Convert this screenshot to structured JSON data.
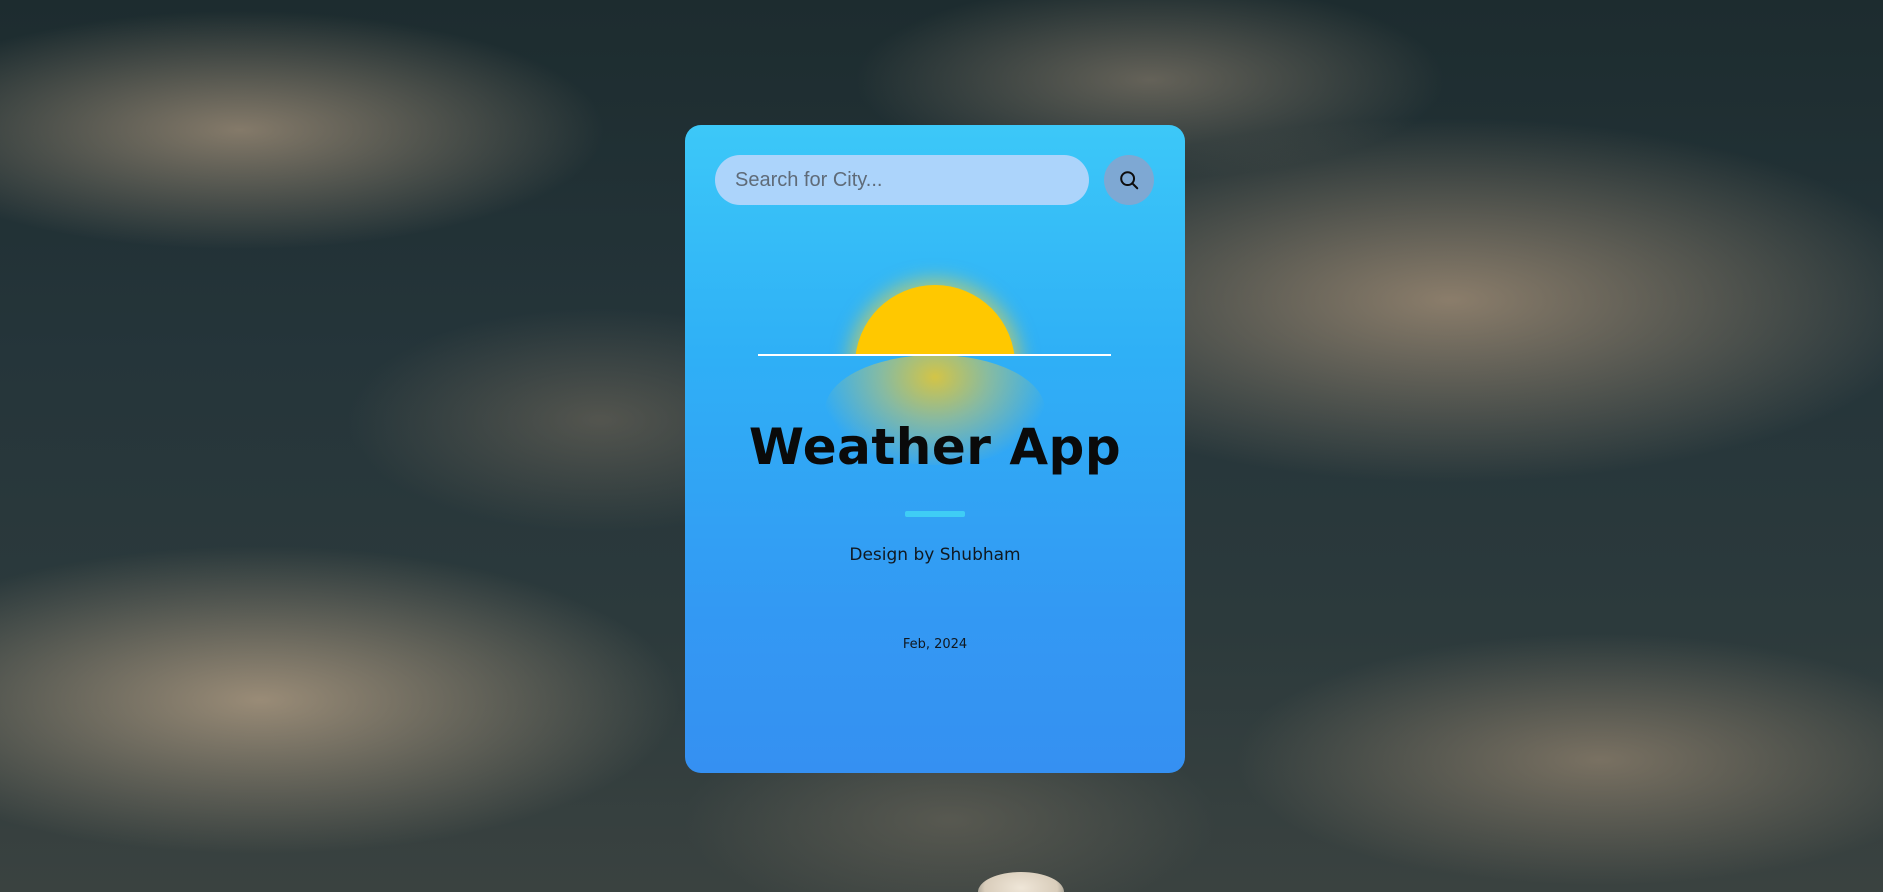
{
  "search": {
    "placeholder": "Search for City...",
    "value": "",
    "button_icon": "search-icon"
  },
  "hero": {
    "illustration": "sunset-icon",
    "title": "Weather App",
    "credit": "Design by Shubham",
    "date": "Feb, 2024"
  },
  "colors": {
    "card_gradient_top": "#3cc8f8",
    "card_gradient_bottom": "#3590f2",
    "sun": "#ffc800",
    "search_field": "#acd4fb",
    "search_button": "#7ea8d3",
    "divider_accent": "#3fcdf5"
  }
}
